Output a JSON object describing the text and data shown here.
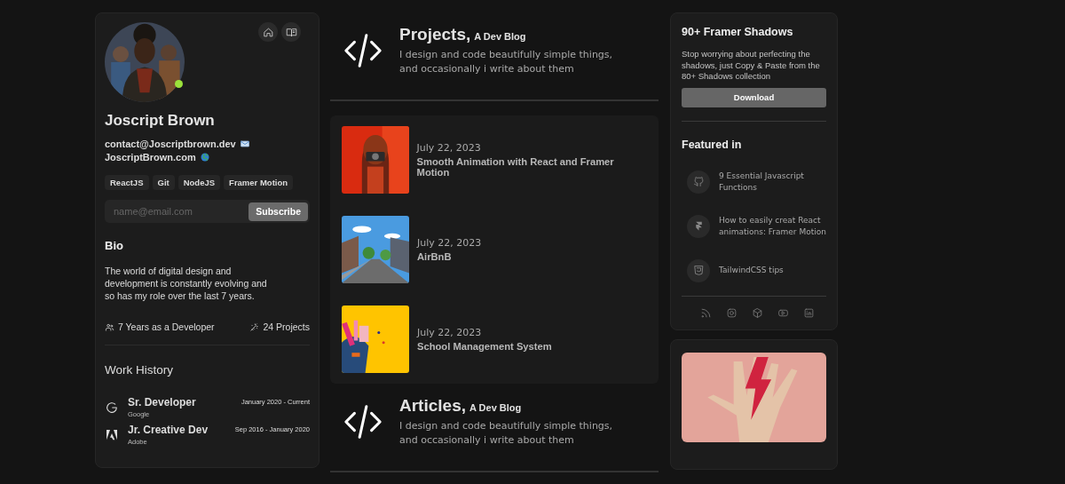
{
  "profile": {
    "online": true,
    "name": "Joscript Brown",
    "email": "contact@Joscriptbrown.dev",
    "website": "JoscriptBrown.com",
    "tags": [
      "ReactJS",
      "Git",
      "NodeJS",
      "Framer Motion"
    ],
    "subscribe": {
      "placeholder": "name@email.com",
      "button": "Subscribe"
    },
    "bio": {
      "title": "Bio",
      "text": "The world of digital design and development is constantly evolving and so has my role over the last 7 years."
    },
    "stats": [
      {
        "kind": "experience",
        "text": "7 Years as a Developer"
      },
      {
        "kind": "projects",
        "text": "24 Projects"
      }
    ],
    "work_history": {
      "title": "Work History",
      "jobs": [
        {
          "kind": "google",
          "role": "Sr. Developer",
          "company": "Google",
          "period": "January 2020 - Current"
        },
        {
          "kind": "adobe",
          "role": "Jr. Creative Dev",
          "company": "Adobe",
          "period": "Sep 2016 - January 2020"
        }
      ]
    }
  },
  "sections": [
    {
      "title": "Projects,",
      "subtitle": "A Dev Blog",
      "description": "I design and code beautifully simple things, and occasionally i write about them",
      "posts": [
        {
          "kind": "camera",
          "date": "July 22, 2023",
          "title": "Smooth Animation with React and Framer Motion"
        },
        {
          "kind": "street",
          "date": "July 22, 2023",
          "title": "AirBnB"
        },
        {
          "kind": "school",
          "date": "July 22, 2023",
          "title": "School Management System"
        }
      ]
    },
    {
      "title": "Articles,",
      "subtitle": "A Dev Blog",
      "description": "I design and code beautifully simple things, and occasionally i write about them"
    }
  ],
  "promo": {
    "title": "90+ Framer Shadows",
    "text": "Stop worrying about perfecting the shadows, just Copy & Paste from the 80+ Shadows collection",
    "button": "Download"
  },
  "featured": {
    "title": "Featured in",
    "items": [
      {
        "kind": "github",
        "text": "9 Essential Javascript Functions"
      },
      {
        "kind": "framer",
        "text": "How to easily creat React animations: Framer Motion"
      },
      {
        "kind": "css",
        "text": "TailwindCSS tips"
      }
    ]
  },
  "social": [
    {
      "kind": "rss"
    },
    {
      "kind": "instagram"
    },
    {
      "kind": "cube"
    },
    {
      "kind": "youtube"
    },
    {
      "kind": "linkedin"
    }
  ]
}
